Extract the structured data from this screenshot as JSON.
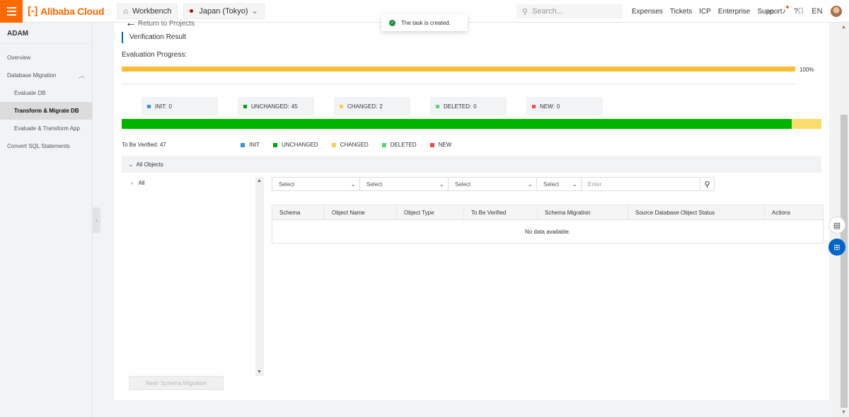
{
  "topbar": {
    "brand": "Alibaba Cloud",
    "workbench_label": "Workbench",
    "region_label": "Japan (Tokyo)",
    "search_placeholder": "Search...",
    "links": [
      "Expenses",
      "Tickets",
      "ICP",
      "Enterprise",
      "Support"
    ],
    "language": "EN",
    "icons": [
      "terminal-icon",
      "bell-icon",
      "help-icon"
    ]
  },
  "sidebar": {
    "title": "ADAM",
    "items": [
      {
        "label": "Overview",
        "level": 0,
        "active": false
      },
      {
        "label": "Database Migration",
        "level": 0,
        "active": false,
        "expanded": true
      },
      {
        "label": "Evaluate DB",
        "level": 1,
        "active": false
      },
      {
        "label": "Transform & Migrate DB",
        "level": 1,
        "active": true
      },
      {
        "label": "Evaluate & Transform App",
        "level": 1,
        "active": false
      },
      {
        "label": "Convert SQL Statements",
        "level": 0,
        "active": false
      }
    ]
  },
  "main": {
    "back_label": "Return to Projects",
    "section_title": "Verification Result",
    "evaluation_label": "Evaluation Progress:",
    "progress_percent": 100,
    "progress_text": "100%",
    "stats": [
      {
        "label": "INIT:",
        "value": "0",
        "color": "#3a8ee6"
      },
      {
        "label": "UNCHANGED:",
        "value": "45",
        "color": "#00a700"
      },
      {
        "label": "CHANGED:",
        "value": "2",
        "color": "#f9cf5a"
      },
      {
        "label": "DELETED:",
        "value": "0",
        "color": "#5fd07f"
      },
      {
        "label": "NEW:",
        "value": "0",
        "color": "#f04a4a"
      }
    ],
    "stack_bar": [
      {
        "name": "INIT",
        "count": 0,
        "color": "#3a8ee6"
      },
      {
        "name": "UNCHANGED",
        "count": 45,
        "color": "#00b400"
      },
      {
        "name": "CHANGED",
        "count": 2,
        "color": "#f9dc6b"
      },
      {
        "name": "DELETED",
        "count": 0,
        "color": "#5fd07f"
      },
      {
        "name": "NEW",
        "count": 0,
        "color": "#f04a4a"
      }
    ],
    "to_be_verified_label": "To Be Verified:",
    "to_be_verified_value": "47",
    "legend": [
      {
        "label": "INIT",
        "color": "#3a8ee6"
      },
      {
        "label": "UNCHANGED",
        "color": "#00a700"
      },
      {
        "label": "CHANGED",
        "color": "#f9cf5a"
      },
      {
        "label": "DELETED",
        "color": "#5fd07f"
      },
      {
        "label": "NEW",
        "color": "#f04a4a"
      }
    ],
    "all_objects_label": "All Objects",
    "tree_root_label": "All",
    "filters": [
      "Select",
      "Select",
      "Select",
      "Select"
    ],
    "filter_input_placeholder": "Enter",
    "table_columns": [
      "Schema",
      "Object Name",
      "Object Type",
      "To Be Verified",
      "Schema Migration",
      "Source Database Object Status",
      "Actions"
    ],
    "empty_text": "No data available.",
    "next_button_label": "Next: Schema Migration"
  },
  "toast": {
    "message": "The task is created."
  },
  "colors": {
    "accent": "#ff6a00",
    "primary": "#0064c8",
    "progress": "#fbbd36"
  }
}
